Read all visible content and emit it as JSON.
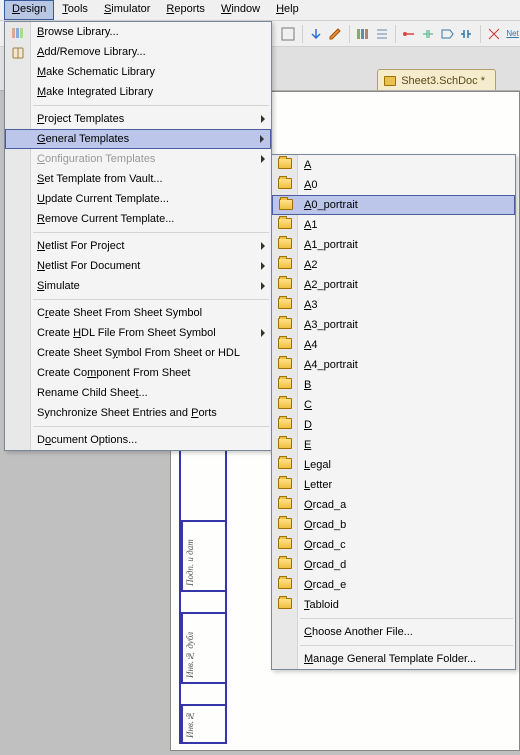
{
  "menubar": {
    "items": [
      {
        "label": "Design",
        "accel": "D",
        "active": true
      },
      {
        "label": "Tools",
        "accel": "T"
      },
      {
        "label": "Simulator",
        "accel": "S"
      },
      {
        "label": "Reports",
        "accel": "R"
      },
      {
        "label": "Window",
        "accel": "W"
      },
      {
        "label": "Help",
        "accel": "H"
      }
    ]
  },
  "doc_tab": {
    "label": "Sheet3.SchDoc *"
  },
  "design_menu": {
    "items": [
      {
        "label": "Browse Library...",
        "accel": "B",
        "icon": "library-icon"
      },
      {
        "label": "Add/Remove Library...",
        "accel": "A",
        "icon": "book-icon"
      },
      {
        "label": "Make Schematic Library",
        "accel": "M"
      },
      {
        "label": "Make Integrated Library",
        "accel": "M"
      },
      {
        "sep": true
      },
      {
        "label": "Project Templates",
        "accel": "P",
        "submenu": true
      },
      {
        "label": "General Templates",
        "accel": "G",
        "submenu": true,
        "highlight": true
      },
      {
        "label": "Configuration Templates",
        "accel": "C",
        "submenu": true,
        "disabled": true
      },
      {
        "label": "Set Template from Vault...",
        "accel": "S"
      },
      {
        "label": "Update Current Template...",
        "accel": "U"
      },
      {
        "label": "Remove Current Template...",
        "accel": "R"
      },
      {
        "sep": true
      },
      {
        "label": "Netlist For Project",
        "accel": "N",
        "submenu": true
      },
      {
        "label": "Netlist For Document",
        "accel": "N",
        "submenu": true
      },
      {
        "label": "Simulate",
        "accel": "S",
        "submenu": true
      },
      {
        "sep": true
      },
      {
        "label": "Create Sheet From Sheet Symbol",
        "accel": "r"
      },
      {
        "label": "Create HDL File From Sheet Symbol",
        "accel": "H",
        "submenu": true
      },
      {
        "label": "Create Sheet Symbol From Sheet or HDL",
        "accel": "Y"
      },
      {
        "label": "Create Component From Sheet",
        "accel": "m"
      },
      {
        "label": "Rename Child Sheet...",
        "accel": "t"
      },
      {
        "label": "Synchronize Sheet Entries and Ports",
        "accel": "P"
      },
      {
        "sep": true
      },
      {
        "label": "Document Options...",
        "accel": "O"
      }
    ]
  },
  "general_templates": {
    "items": [
      {
        "label": "A",
        "accel": "A"
      },
      {
        "label": "A0",
        "accel": "A"
      },
      {
        "label": "A0_portrait",
        "accel": "A",
        "highlight": true
      },
      {
        "label": "A1",
        "accel": "A"
      },
      {
        "label": "A1_portrait",
        "accel": "A"
      },
      {
        "label": "A2",
        "accel": "A"
      },
      {
        "label": "A2_portrait",
        "accel": "A"
      },
      {
        "label": "A3",
        "accel": "A"
      },
      {
        "label": "A3_portrait",
        "accel": "A"
      },
      {
        "label": "A4",
        "accel": "A"
      },
      {
        "label": "A4_portrait",
        "accel": "A"
      },
      {
        "label": "B",
        "accel": "B"
      },
      {
        "label": "C",
        "accel": "C"
      },
      {
        "label": "D",
        "accel": "D"
      },
      {
        "label": "E",
        "accel": "E"
      },
      {
        "label": "Legal",
        "accel": "L"
      },
      {
        "label": "Letter",
        "accel": "L"
      },
      {
        "label": "Orcad_a",
        "accel": "O"
      },
      {
        "label": "Orcad_b",
        "accel": "O"
      },
      {
        "label": "Orcad_c",
        "accel": "O"
      },
      {
        "label": "Orcad_d",
        "accel": "O"
      },
      {
        "label": "Orcad_e",
        "accel": "O"
      },
      {
        "label": "Tabloid",
        "accel": "T"
      }
    ],
    "footer": [
      {
        "label": "Choose Another File...",
        "accel": "C"
      },
      {
        "label": "Manage General Template Folder...",
        "accel": "M"
      }
    ]
  },
  "titleblock": {
    "labels": [
      "Подп. и дат",
      "Инв.№ дубл",
      "Инв.№"
    ]
  }
}
